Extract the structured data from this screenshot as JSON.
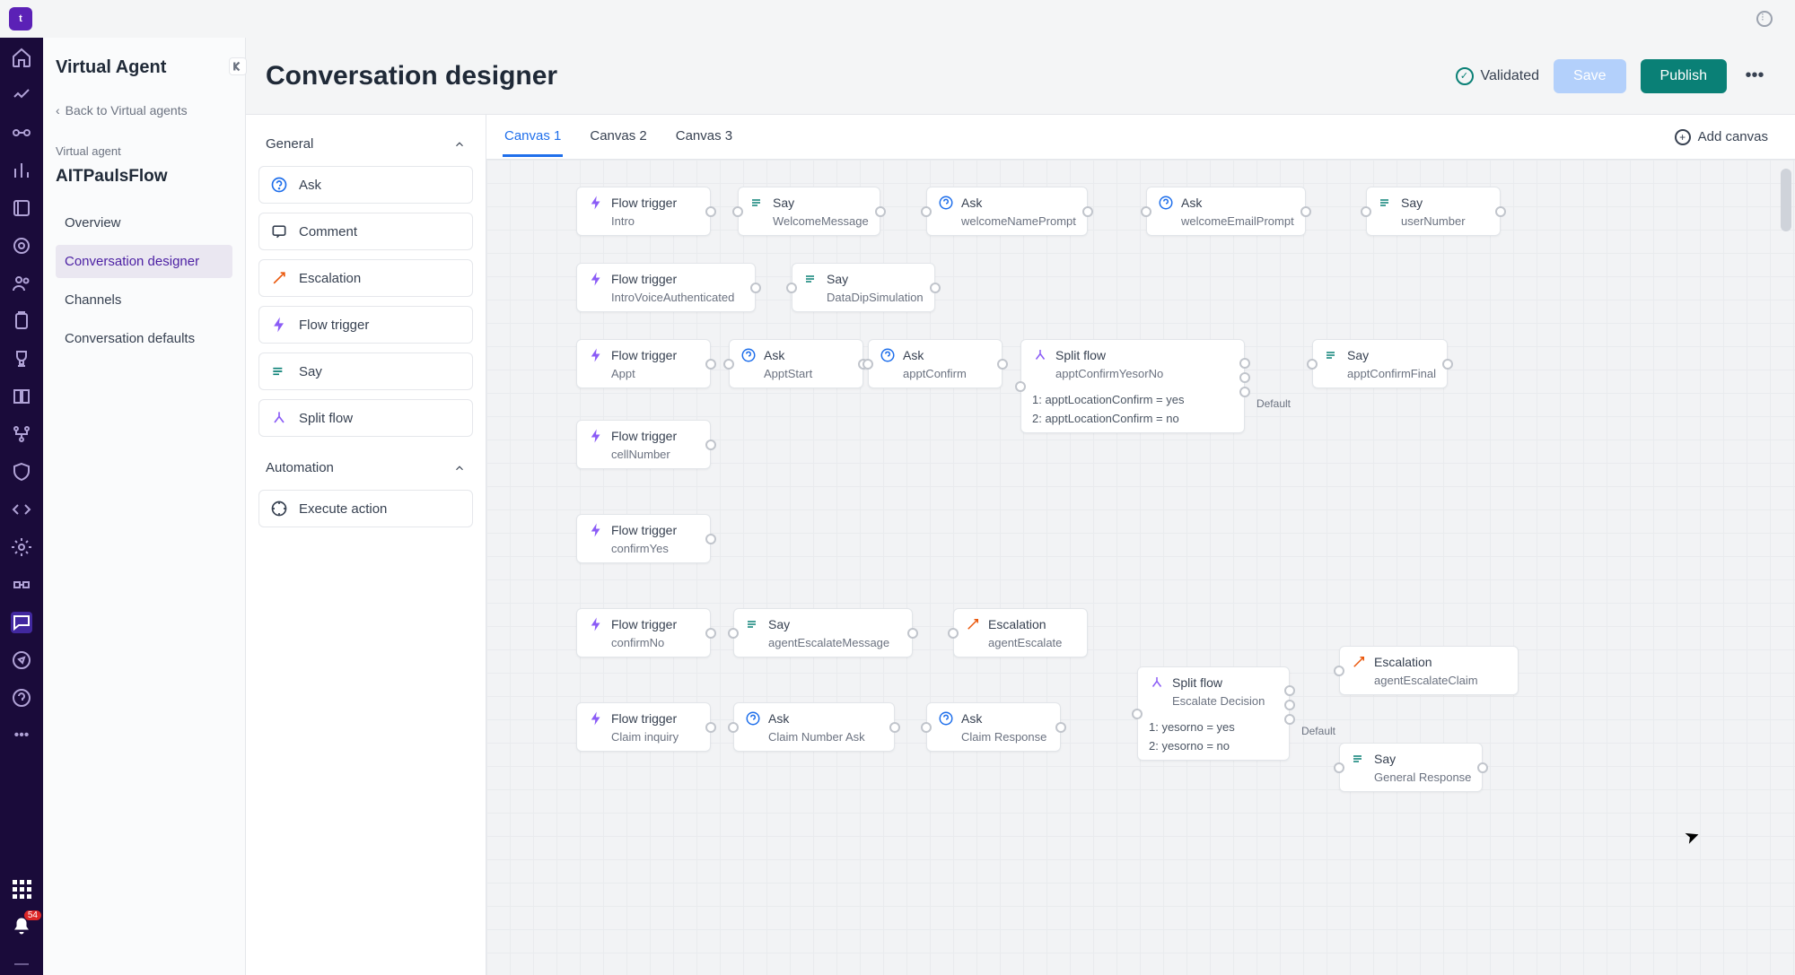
{
  "titlebar": {
    "logo": "t"
  },
  "rail": {
    "badge": "54",
    "items": [
      "home-icon",
      "analytics-icon",
      "connections-icon",
      "stats-icon",
      "library-icon",
      "target-icon",
      "users-icon",
      "clipboard-icon",
      "trophy-icon",
      "book-icon",
      "branch-icon",
      "shield-icon",
      "code-icon",
      "config-icon",
      "devops-icon",
      "chat-icon",
      "compass-icon",
      "support-icon",
      "more-icon"
    ],
    "active_index": 15
  },
  "sidebar": {
    "title": "Virtual Agent",
    "back": "Back to Virtual agents",
    "category_label": "Virtual agent",
    "flow_name": "AITPaulsFlow",
    "nav": [
      {
        "label": "Overview"
      },
      {
        "label": "Conversation designer"
      },
      {
        "label": "Channels"
      },
      {
        "label": "Conversation defaults"
      }
    ],
    "selected_index": 1
  },
  "palette": {
    "groups": [
      {
        "name": "General",
        "items": [
          {
            "label": "Ask",
            "icon": "ask"
          },
          {
            "label": "Comment",
            "icon": "comment"
          },
          {
            "label": "Escalation",
            "icon": "escalation"
          },
          {
            "label": "Flow trigger",
            "icon": "trigger"
          },
          {
            "label": "Say",
            "icon": "say"
          },
          {
            "label": "Split flow",
            "icon": "split"
          }
        ]
      },
      {
        "name": "Automation",
        "items": [
          {
            "label": "Execute action",
            "icon": "execute"
          }
        ]
      }
    ]
  },
  "header": {
    "title": "Conversation designer",
    "validated": "Validated",
    "save": "Save",
    "publish": "Publish"
  },
  "tabs": {
    "items": [
      "Canvas 1",
      "Canvas 2",
      "Canvas 3"
    ],
    "active_index": 0,
    "add": "Add canvas"
  },
  "node_labels": {
    "flow_trigger": "Flow trigger",
    "say": "Say",
    "ask": "Ask",
    "split_flow": "Split flow",
    "escalation": "Escalation",
    "default": "Default"
  },
  "canvas": {
    "row1": {
      "t1": "Intro",
      "s1": "WelcomeMessage",
      "a1": "welcomeNamePrompt",
      "a2": "welcomeEmailPrompt",
      "s2": "userNumber"
    },
    "row2": {
      "t": "IntroVoiceAuthenticated",
      "s": "DataDipSimulation"
    },
    "row3": {
      "t": "Appt",
      "a1": "ApptStart",
      "a2": "apptConfirm",
      "split_name": "apptConfirmYesorNo",
      "rule1": "1: apptLocationConfirm = yes",
      "rule2": "2: apptLocationConfirm = no",
      "say": "apptConfirmFinal"
    },
    "row4": {
      "t": "cellNumber"
    },
    "row5": {
      "t": "confirmYes"
    },
    "row6": {
      "t": "confirmNo",
      "s": "agentEscalateMessage",
      "e": "agentEscalate"
    },
    "row7": {
      "t": "Claim inquiry",
      "a1": "Claim Number Ask",
      "a2": "Claim Response",
      "split_name": "Escalate Decision",
      "rule1": "1: yesorno = yes",
      "rule2": "2: yesorno = no",
      "e": "agentEscalateClaim",
      "say": "General Response"
    }
  }
}
